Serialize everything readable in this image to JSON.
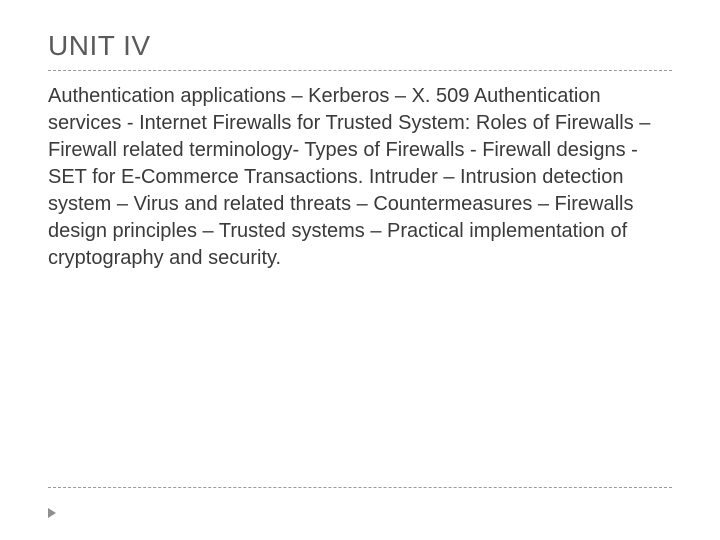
{
  "slide": {
    "title": "UNIT IV",
    "body": "Authentication applications – Kerberos – X. 509 Authentication services - Internet Firewalls for Trusted System: Roles of Firewalls – Firewall related terminology- Types of Firewalls - Firewall designs - SET for E-Commerce Transactions. Intruder – Intrusion detection system – Virus and related threats – Countermeasures – Firewalls design principles – Trusted systems – Practical implementation of cryptography and security."
  }
}
